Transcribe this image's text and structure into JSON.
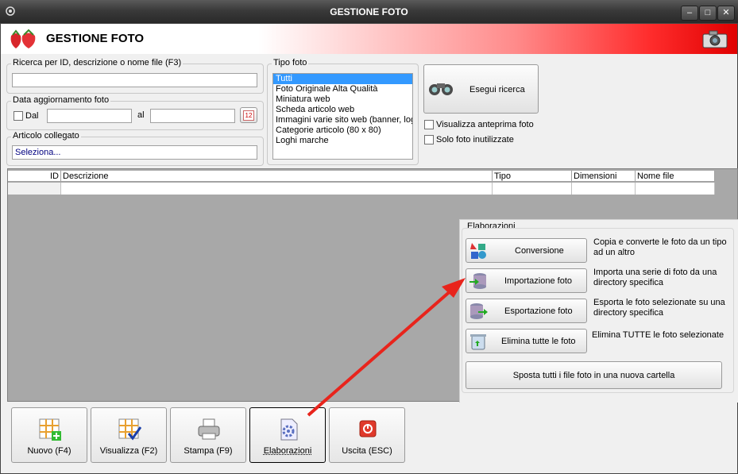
{
  "window": {
    "title": "GESTIONE FOTO",
    "min": "–",
    "max": "□",
    "close": "✕"
  },
  "header": {
    "title": "GESTIONE FOTO"
  },
  "search": {
    "label": "Ricerca per ID, descrizione o nome file (F3)",
    "value": ""
  },
  "date": {
    "label": "Data aggiornamento foto",
    "from_label": "Dal",
    "to_label": "al",
    "from_value": "",
    "to_value": "",
    "calendar_text": "12"
  },
  "articolo": {
    "label": "Articolo collegato",
    "value": "Seleziona..."
  },
  "tipo_foto": {
    "label": "Tipo foto",
    "items": [
      "Tutti",
      "Foto Originale Alta Qualità",
      "Miniatura web",
      "Scheda articolo web",
      "Immagini varie sito web (banner, loghi",
      "Categorie articolo (80 x 80)",
      "Loghi marche"
    ],
    "selected": "Tutti"
  },
  "search_button": {
    "label": "Esegui ricerca"
  },
  "options": {
    "preview": "Visualizza anteprima foto",
    "unused": "Solo foto inutilizzate"
  },
  "table": {
    "columns": [
      "ID",
      "Descrizione",
      "Tipo",
      "Dimensioni",
      "Nome file"
    ]
  },
  "elaborazioni": {
    "title": "Elaborazioni",
    "actions": [
      {
        "label": "Conversione",
        "desc": "Copia e converte le foto da un tipo ad un altro"
      },
      {
        "label": "Importazione foto",
        "desc": "Importa una serie di foto da una directory specifica"
      },
      {
        "label": "Esportazione foto",
        "desc": "Esporta le foto selezionate su una directory specifica"
      },
      {
        "label": "Elimina tutte le foto",
        "desc": "Elimina TUTTE le foto selezionate"
      }
    ],
    "move_button": "Sposta tutti i file foto in una nuova cartella"
  },
  "bottom": {
    "nuovo": "Nuovo (F4)",
    "visualizza": "Visualizza (F2)",
    "stampa": "Stampa (F9)",
    "elaborazioni": "Elaborazioni",
    "uscita": "Uscita (ESC)"
  },
  "colors": {
    "header_red": "#ff2d2d",
    "selection": "#3399ff",
    "arrow": "#e8241c"
  }
}
